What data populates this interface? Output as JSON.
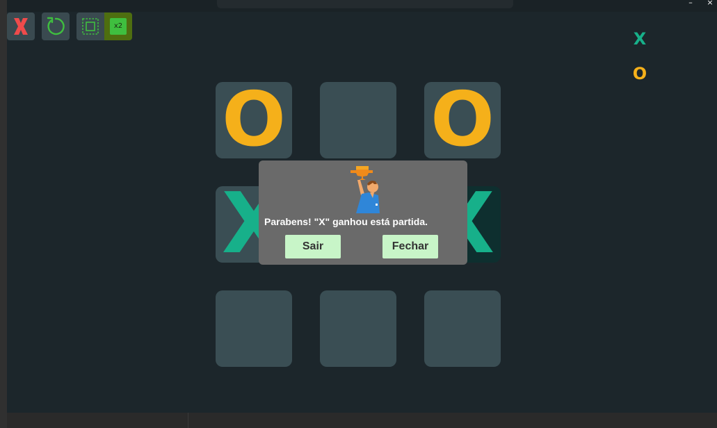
{
  "window": {
    "minimize_glyph": "–",
    "close_glyph": "×"
  },
  "toolbar": {
    "close_icon": "close-x-icon",
    "restart_icon": "restart-icon",
    "frame_icon": "frame-icon",
    "speed_label": "x2"
  },
  "scoreboard": {
    "x_label": "X",
    "o_label": "O"
  },
  "board": {
    "cells": [
      "O",
      "",
      "O",
      "X",
      "",
      "X",
      "",
      "",
      ""
    ]
  },
  "dialog": {
    "icon": "trophy-person-icon",
    "message": "Parabens! \"X\" ganhou está partida.",
    "exit_label": "Sair",
    "close_label": "Fechar"
  },
  "colors": {
    "x_color": "#17b08a",
    "o_color": "#f5b01a",
    "cell_color": "#3a4e54",
    "win_cell_color": "#0e2f2f",
    "background": "#1c262b",
    "dialog_bg": "#6a6a6a",
    "dialog_button": "#c8f5c8"
  }
}
